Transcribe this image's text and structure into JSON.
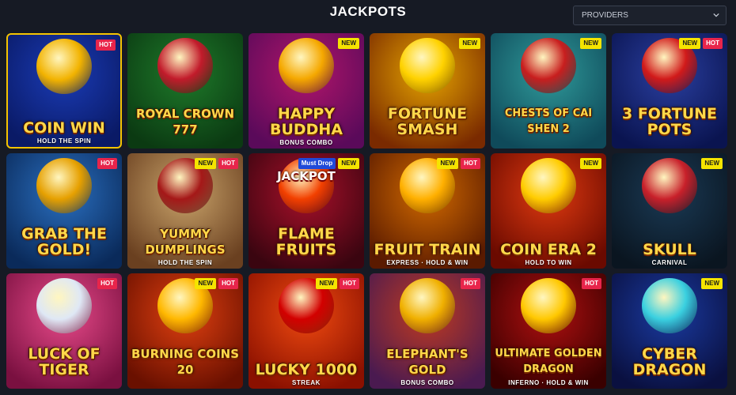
{
  "header": {
    "title": "JACKPOTS",
    "providers_label": "PROVIDERS"
  },
  "games": [
    {
      "name": "COIN WIN",
      "sub": "HOLD THE SPIN",
      "badges": [
        "HOT"
      ],
      "bg": [
        "#1a3bb5",
        "#0a1a66"
      ],
      "orb": "#f2b300",
      "selected": true
    },
    {
      "name": "ROYAL CROWN 777",
      "sub": "",
      "badges": [],
      "bg": [
        "#1e7a2a",
        "#0b3a12"
      ],
      "orb": "#c21b2b",
      "selected": false
    },
    {
      "name": "HAPPY BUDDHA",
      "sub": "BONUS COMBO",
      "badges": [
        "NEW"
      ],
      "bg": [
        "#b0156a",
        "#5a0a5a"
      ],
      "orb": "#f5a800",
      "selected": false
    },
    {
      "name": "Fortune SMASH",
      "sub": "",
      "badges": [
        "NEW"
      ],
      "bg": [
        "#e5a400",
        "#7a2a00"
      ],
      "orb": "#ffd200",
      "selected": false
    },
    {
      "name": "Chests of CAI SHEN 2",
      "sub": "",
      "badges": [
        "NEW"
      ],
      "bg": [
        "#2f9a9a",
        "#0f4a5a"
      ],
      "orb": "#c81e1e",
      "selected": false
    },
    {
      "name": "3 FORTUNE POTS",
      "sub": "",
      "badges": [
        "NEW",
        "HOT"
      ],
      "bg": [
        "#2a3fa0",
        "#0a1450"
      ],
      "orb": "#d11a1a",
      "selected": false
    },
    {
      "name": "GRAB THE GOLD!",
      "sub": "",
      "badges": [
        "HOT"
      ],
      "bg": [
        "#2a6fc0",
        "#0a2a5a"
      ],
      "orb": "#e6a000",
      "selected": false
    },
    {
      "name": "YUMMY DUMPLINGS",
      "sub": "HOLD THE SPIN",
      "badges": [
        "NEW",
        "HOT"
      ],
      "bg": [
        "#c9a36a",
        "#6a4020"
      ],
      "orb": "#a51818",
      "selected": false
    },
    {
      "name": "FLAME FRUITS",
      "sub": "",
      "badges": [
        "Must Drop",
        "NEW"
      ],
      "topline": "JACKPOT",
      "bg": [
        "#a8102a",
        "#3a0510"
      ],
      "orb": "#f24000",
      "selected": false
    },
    {
      "name": "FRUIT TRAIN",
      "sub": "EXPRESS · HOLD & WIN",
      "badges": [
        "NEW",
        "HOT"
      ],
      "bg": [
        "#d16a00",
        "#5a1a00"
      ],
      "orb": "#ffb000",
      "selected": false
    },
    {
      "name": "COIN ERA 2",
      "sub": "HOLD TO WIN",
      "badges": [
        "NEW"
      ],
      "bg": [
        "#e03a10",
        "#6a0a00"
      ],
      "orb": "#ffcc00",
      "selected": false
    },
    {
      "name": "SKULL",
      "sub": "CARNIVAL",
      "badges": [
        "NEW"
      ],
      "bg": [
        "#1a3a55",
        "#0a1520"
      ],
      "orb": "#c8202a",
      "selected": false
    },
    {
      "name": "LUCK of TIGER",
      "sub": "",
      "badges": [
        "HOT"
      ],
      "bg": [
        "#e84a8a",
        "#7a1040"
      ],
      "orb": "#dfe8f5",
      "selected": false
    },
    {
      "name": "BURNING COINS 20",
      "sub": "",
      "badges": [
        "NEW",
        "HOT"
      ],
      "bg": [
        "#e04010",
        "#6a1000"
      ],
      "orb": "#ffb800",
      "selected": false
    },
    {
      "name": "Lucky 1000",
      "sub": "STREAK",
      "badges": [
        "NEW",
        "HOT"
      ],
      "bg": [
        "#f04a10",
        "#8a1000"
      ],
      "orb": "#d20000",
      "selected": false
    },
    {
      "name": "ELEPHANT'S GOLD",
      "sub": "BONUS COMBO",
      "badges": [
        "HOT"
      ],
      "bg": [
        "#c03a20",
        "#4a1a50"
      ],
      "orb": "#f0b000",
      "selected": false
    },
    {
      "name": "ULTIMATE GOLDEN DRAGON",
      "sub": "INFERNO · HOLD & WIN",
      "badges": [
        "HOT"
      ],
      "bg": [
        "#b01010",
        "#3a0000"
      ],
      "orb": "#ffc800",
      "selected": false
    },
    {
      "name": "CYBER DRAGON",
      "sub": "",
      "badges": [
        "NEW"
      ],
      "bg": [
        "#1a3aa0",
        "#0a1040"
      ],
      "orb": "#3ad0e0",
      "selected": false
    }
  ]
}
